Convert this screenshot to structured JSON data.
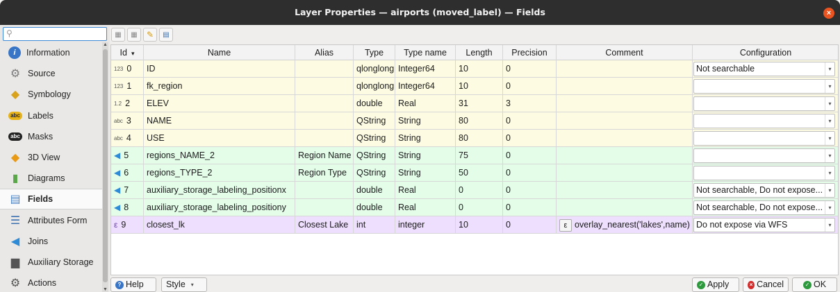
{
  "window": {
    "title": "Layer Properties — airports (moved_label) — Fields",
    "close_icon": "×"
  },
  "search": {
    "placeholder": ""
  },
  "sidebar": {
    "items": [
      {
        "label": "Information",
        "icon": "info-icon",
        "glyph": "i",
        "color": "#3875c6",
        "active": false
      },
      {
        "label": "Source",
        "icon": "source-icon",
        "glyph": "⚙",
        "color": "#7a7a7a",
        "active": false
      },
      {
        "label": "Symbology",
        "icon": "symbology-icon",
        "glyph": "◆",
        "color": "#d8a21c",
        "active": false
      },
      {
        "label": "Labels",
        "icon": "labels-icon",
        "glyph": "abc",
        "color": "#e6b31b",
        "active": false
      },
      {
        "label": "Masks",
        "icon": "masks-icon",
        "glyph": "abc",
        "color": "#222",
        "active": false
      },
      {
        "label": "3D View",
        "icon": "3d-view-icon",
        "glyph": "◆",
        "color": "#e89a16",
        "active": false
      },
      {
        "label": "Diagrams",
        "icon": "diagrams-icon",
        "glyph": "▮",
        "color": "#5ba64a",
        "active": false
      },
      {
        "label": "Fields",
        "icon": "fields-icon",
        "glyph": "▤",
        "color": "#4f86c6",
        "active": true
      },
      {
        "label": "Attributes Form",
        "icon": "attributes-form-icon",
        "glyph": "☰",
        "color": "#3a6fb0",
        "active": false
      },
      {
        "label": "Joins",
        "icon": "joins-icon",
        "glyph": "◀",
        "color": "#2f8bd6",
        "active": false
      },
      {
        "label": "Auxiliary Storage",
        "icon": "auxiliary-storage-icon",
        "glyph": "▆",
        "color": "#555",
        "active": false
      },
      {
        "label": "Actions",
        "icon": "actions-icon",
        "glyph": "⚙",
        "color": "#555",
        "active": false
      }
    ]
  },
  "toolbar": {
    "buttons": [
      {
        "name": "new-field-icon",
        "glyph": "▦"
      },
      {
        "name": "delete-field-icon",
        "glyph": "▦"
      },
      {
        "name": "toggle-editing-icon",
        "glyph": "✎"
      },
      {
        "name": "field-calculator-icon",
        "glyph": "▤"
      }
    ]
  },
  "table": {
    "columns": [
      "Id",
      "Name",
      "Alias",
      "Type",
      "Type name",
      "Length",
      "Precision",
      "Comment",
      "Configuration"
    ],
    "sort_indicator": "▾",
    "rows": [
      {
        "tag": "123",
        "id": "0",
        "name": "ID",
        "alias": "",
        "type": "qlonglong",
        "typename": "Integer64",
        "length": "10",
        "precision": "0",
        "comment": "",
        "config": "Not searchable",
        "kind": "provider"
      },
      {
        "tag": "123",
        "id": "1",
        "name": "fk_region",
        "alias": "",
        "type": "qlonglong",
        "typename": "Integer64",
        "length": "10",
        "precision": "0",
        "comment": "",
        "config": "",
        "kind": "provider"
      },
      {
        "tag": "1.2",
        "id": "2",
        "name": "ELEV",
        "alias": "",
        "type": "double",
        "typename": "Real",
        "length": "31",
        "precision": "3",
        "comment": "",
        "config": "",
        "kind": "provider"
      },
      {
        "tag": "abc",
        "id": "3",
        "name": "NAME",
        "alias": "",
        "type": "QString",
        "typename": "String",
        "length": "80",
        "precision": "0",
        "comment": "",
        "config": "",
        "kind": "provider"
      },
      {
        "tag": "abc",
        "id": "4",
        "name": "USE",
        "alias": "",
        "type": "QString",
        "typename": "String",
        "length": "80",
        "precision": "0",
        "comment": "",
        "config": "",
        "kind": "provider"
      },
      {
        "tag": "",
        "id": "5",
        "name": "regions_NAME_2",
        "alias": "Region Name",
        "type": "QString",
        "typename": "String",
        "length": "75",
        "precision": "0",
        "comment": "",
        "config": "",
        "kind": "join"
      },
      {
        "tag": "",
        "id": "6",
        "name": "regions_TYPE_2",
        "alias": "Region Type",
        "type": "QString",
        "typename": "String",
        "length": "50",
        "precision": "0",
        "comment": "",
        "config": "",
        "kind": "join"
      },
      {
        "tag": "",
        "id": "7",
        "name": "auxiliary_storage_labeling_positionx",
        "alias": "",
        "type": "double",
        "typename": "Real",
        "length": "0",
        "precision": "0",
        "comment": "",
        "config": "Not searchable, Do not expose...",
        "kind": "join"
      },
      {
        "tag": "",
        "id": "8",
        "name": "auxiliary_storage_labeling_positiony",
        "alias": "",
        "type": "double",
        "typename": "Real",
        "length": "0",
        "precision": "0",
        "comment": "",
        "config": "Not searchable, Do not expose...",
        "kind": "join"
      },
      {
        "tag": "ε",
        "id": "9",
        "name": "closest_lk",
        "alias": "Closest Lake",
        "type": "int",
        "typename": "integer",
        "length": "10",
        "precision": "0",
        "comment": "overlay_nearest('lakes',name)",
        "config": "Do not expose via WFS",
        "kind": "expression"
      }
    ]
  },
  "colors": {
    "provider": "#fdfce3",
    "join": "#e3fde9",
    "expression": "#eddffd"
  },
  "buttons": {
    "help": "Help",
    "style": "Style",
    "apply": "Apply",
    "cancel": "Cancel",
    "ok": "OK"
  }
}
